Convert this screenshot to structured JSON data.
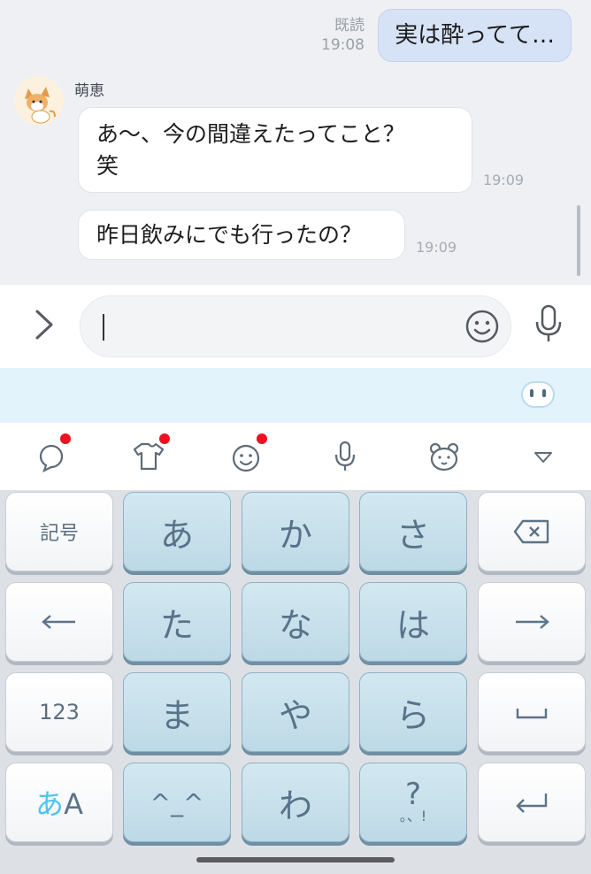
{
  "chat": {
    "sent_message": "実は酔ってて…",
    "read_label": "既読",
    "sent_time": "19:08",
    "sender_name": "萌恵",
    "messages": [
      {
        "text_line1": "あ〜、今の間違えたってこと？",
        "text_line2": "笑",
        "time": "19:09"
      },
      {
        "text": "昨日飲みにでも行ったの？",
        "time": "19:09"
      }
    ]
  },
  "input": {
    "value": "",
    "placeholder": ""
  },
  "toolbar": {
    "icons": [
      "sticker-chat-icon",
      "tshirt-icon",
      "smiley-icon",
      "mic-icon",
      "bear-icon",
      "collapse-icon"
    ],
    "badge_color": "#f0101f"
  },
  "keyboard": {
    "rows": [
      [
        "記号",
        "あ",
        "か",
        "さ",
        "⌫"
      ],
      [
        "←",
        "た",
        "な",
        "は",
        "→"
      ],
      [
        "123",
        "ま",
        "や",
        "ら",
        "␣"
      ],
      [
        "あA",
        "^_^",
        "わ",
        "?",
        "↵"
      ]
    ],
    "mode_kana": "あ",
    "mode_latin": "A",
    "punct_sub": "。、!",
    "accent_color": "#4ec3f0"
  }
}
